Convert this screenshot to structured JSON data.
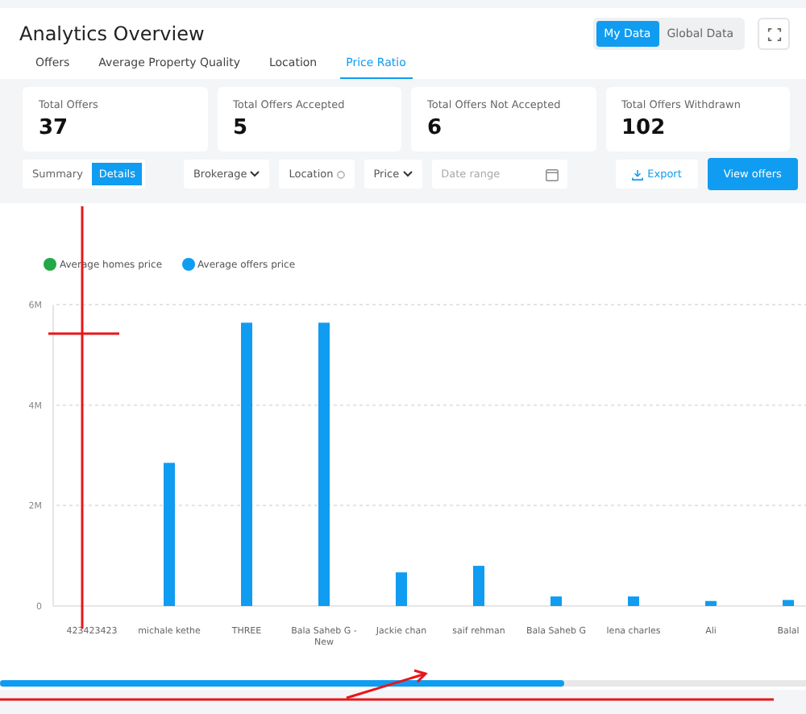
{
  "header": {
    "title": "Analytics Overview",
    "data_toggle": [
      {
        "label": "My Data",
        "selected": true
      },
      {
        "label": "Global Data",
        "selected": false
      }
    ]
  },
  "tabs": [
    {
      "label": "Offers",
      "selected": false
    },
    {
      "label": "Average Property Quality",
      "selected": false
    },
    {
      "label": "Location",
      "selected": false
    },
    {
      "label": "Price Ratio",
      "selected": true
    }
  ],
  "stats": [
    {
      "label": "Total Offers",
      "value": "37"
    },
    {
      "label": "Total Offers Accepted",
      "value": "5"
    },
    {
      "label": "Total Offers Not Accepted",
      "value": "6"
    },
    {
      "label": "Total Offers Withdrawn",
      "value": "102"
    }
  ],
  "view_toggle": [
    {
      "label": "Summary",
      "selected": false
    },
    {
      "label": "Details",
      "selected": true
    }
  ],
  "filters": [
    {
      "kind": "dropdown",
      "label": "Brokerage"
    },
    {
      "kind": "info",
      "label": "Location"
    },
    {
      "kind": "dropdown",
      "label": "Price"
    }
  ],
  "date_range": {
    "placeholder": "Date range"
  },
  "actions": {
    "export": "Export",
    "view": "View offers"
  },
  "chart": {
    "chart_data": {
      "type": "bar",
      "categories": [
        "423423423",
        "michale kethe",
        "THREE",
        "Bala Saheb G - New",
        "Jackie chan",
        "saif rehman",
        "Bala Saheb G",
        "lena charles",
        "Ali",
        "Balal"
      ],
      "series": [
        {
          "name": "Average homes price",
          "color": "#22a846",
          "values": [
            0,
            0,
            0,
            0,
            0,
            0,
            0,
            0,
            0,
            0
          ]
        },
        {
          "name": "Average offers price",
          "color": "#109cf1",
          "values": [
            0,
            2850000,
            5640000,
            5640000,
            670000,
            800000,
            190000,
            190000,
            100000,
            120000
          ]
        }
      ],
      "ylim": [
        0,
        6000000
      ],
      "yticks": [
        {
          "value": 0,
          "label": "0"
        },
        {
          "value": 2000000,
          "label": "2M"
        },
        {
          "value": 4000000,
          "label": "4M"
        },
        {
          "value": 6000000,
          "label": "6M"
        }
      ]
    }
  }
}
